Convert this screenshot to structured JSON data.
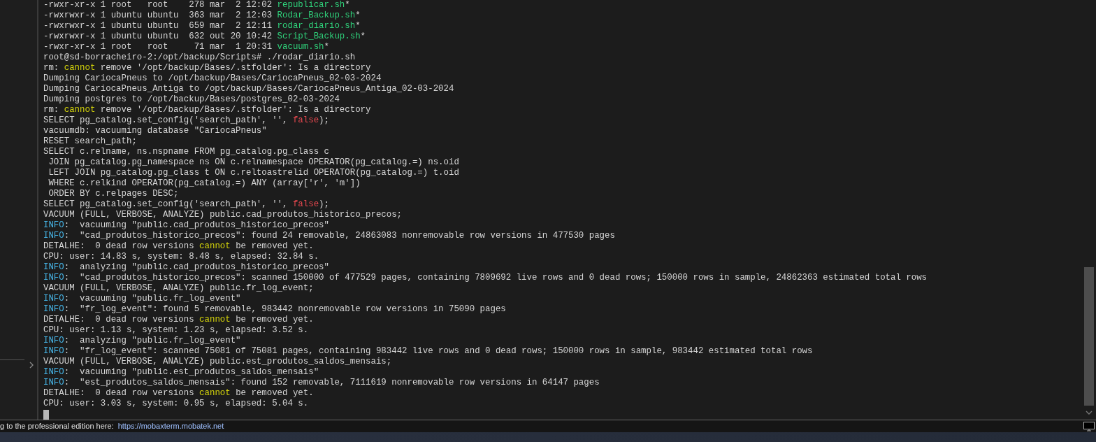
{
  "terminal": {
    "lines": [
      [
        {
          "text": "-rwxr-xr-x 1 root   root    278 mar  2 12:02 ",
          "kind": "plain"
        },
        {
          "text": "republicar.sh",
          "kind": "file"
        },
        {
          "text": "*",
          "kind": "plain"
        }
      ],
      [
        {
          "text": "-rwxrwxr-x 1 ubuntu ubuntu  363 mar  2 12:03 ",
          "kind": "plain"
        },
        {
          "text": "Rodar_Backup.sh",
          "kind": "file"
        },
        {
          "text": "*",
          "kind": "plain"
        }
      ],
      [
        {
          "text": "-rwxrwxr-x 1 ubuntu ubuntu  659 mar  2 12:11 ",
          "kind": "plain"
        },
        {
          "text": "rodar_diario.sh",
          "kind": "file"
        },
        {
          "text": "*",
          "kind": "plain"
        }
      ],
      [
        {
          "text": "-rwxrwxr-x 1 ubuntu ubuntu  632 out 20 10:42 ",
          "kind": "plain"
        },
        {
          "text": "Script_Backup.sh",
          "kind": "file"
        },
        {
          "text": "*",
          "kind": "plain"
        }
      ],
      [
        {
          "text": "-rwxr-xr-x 1 root   root     71 mar  1 20:31 ",
          "kind": "plain"
        },
        {
          "text": "vacuum.sh",
          "kind": "file"
        },
        {
          "text": "*",
          "kind": "plain"
        }
      ],
      [
        {
          "text": "root@sd-borracheiro-2:/opt/backup/Scripts# ./rodar_diario.sh",
          "kind": "plain"
        }
      ],
      [
        {
          "text": "rm: ",
          "kind": "plain"
        },
        {
          "text": "cannot",
          "kind": "warn"
        },
        {
          "text": " remove '/opt/backup/Bases/.stfolder': Is a directory",
          "kind": "plain"
        }
      ],
      [
        {
          "text": "Dumping CariocaPneus to /opt/backup/Bases/CariocaPneus_02-03-2024",
          "kind": "plain"
        }
      ],
      [
        {
          "text": "Dumping CariocaPneus_Antiga to /opt/backup/Bases/CariocaPneus_Antiga_02-03-2024",
          "kind": "plain"
        }
      ],
      [
        {
          "text": "Dumping postgres to /opt/backup/Bases/postgres_02-03-2024",
          "kind": "plain"
        }
      ],
      [
        {
          "text": "rm: ",
          "kind": "plain"
        },
        {
          "text": "cannot",
          "kind": "warn"
        },
        {
          "text": " remove '/opt/backup/Bases/.stfolder': Is a directory",
          "kind": "plain"
        }
      ],
      [
        {
          "text": "SELECT pg_catalog.set_config('search_path', '', ",
          "kind": "plain"
        },
        {
          "text": "false",
          "kind": "bool"
        },
        {
          "text": ");",
          "kind": "plain"
        }
      ],
      [
        {
          "text": "vacuumdb: vacuuming database \"CariocaPneus\"",
          "kind": "plain"
        }
      ],
      [
        {
          "text": "RESET search_path;",
          "kind": "plain"
        }
      ],
      [
        {
          "text": "SELECT c.relname, ns.nspname FROM pg_catalog.pg_class c",
          "kind": "plain"
        }
      ],
      [
        {
          "text": " JOIN pg_catalog.pg_namespace ns ON c.relnamespace OPERATOR(pg_catalog.=) ns.oid",
          "kind": "plain"
        }
      ],
      [
        {
          "text": " LEFT JOIN pg_catalog.pg_class t ON c.reltoastrelid OPERATOR(pg_catalog.=) t.oid",
          "kind": "plain"
        }
      ],
      [
        {
          "text": " WHERE c.relkind OPERATOR(pg_catalog.=) ANY (array['r', 'm'])",
          "kind": "plain"
        }
      ],
      [
        {
          "text": " ORDER BY c.relpages DESC;",
          "kind": "plain"
        }
      ],
      [
        {
          "text": "SELECT pg_catalog.set_config('search_path', '', ",
          "kind": "plain"
        },
        {
          "text": "false",
          "kind": "bool"
        },
        {
          "text": ");",
          "kind": "plain"
        }
      ],
      [
        {
          "text": "VACUUM (FULL, VERBOSE, ANALYZE) public.cad_produtos_historico_precos;",
          "kind": "plain"
        }
      ],
      [
        {
          "text": "INFO",
          "kind": "info"
        },
        {
          "text": ":  vacuuming \"public.cad_produtos_historico_precos\"",
          "kind": "plain"
        }
      ],
      [
        {
          "text": "INFO",
          "kind": "info"
        },
        {
          "text": ":  \"cad_produtos_historico_precos\": found 24 removable, 24863083 nonremovable row versions in 477530 pages",
          "kind": "plain"
        }
      ],
      [
        {
          "text": "DETALHE:  0 dead row versions ",
          "kind": "plain"
        },
        {
          "text": "cannot",
          "kind": "warn"
        },
        {
          "text": " be removed yet.",
          "kind": "plain"
        }
      ],
      [
        {
          "text": "CPU: user: 14.83 s, system: 8.48 s, elapsed: 32.84 s.",
          "kind": "plain"
        }
      ],
      [
        {
          "text": "INFO",
          "kind": "info"
        },
        {
          "text": ":  analyzing \"public.cad_produtos_historico_precos\"",
          "kind": "plain"
        }
      ],
      [
        {
          "text": "INFO",
          "kind": "info"
        },
        {
          "text": ":  \"cad_produtos_historico_precos\": scanned 150000 of 477529 pages, containing 7809692 live rows and 0 dead rows; 150000 rows in sample, 24862363 estimated total rows",
          "kind": "plain"
        }
      ],
      [
        {
          "text": "VACUUM (FULL, VERBOSE, ANALYZE) public.fr_log_event;",
          "kind": "plain"
        }
      ],
      [
        {
          "text": "INFO",
          "kind": "info"
        },
        {
          "text": ":  vacuuming \"public.fr_log_event\"",
          "kind": "plain"
        }
      ],
      [
        {
          "text": "INFO",
          "kind": "info"
        },
        {
          "text": ":  \"fr_log_event\": found 5 removable, 983442 nonremovable row versions in 75090 pages",
          "kind": "plain"
        }
      ],
      [
        {
          "text": "DETALHE:  0 dead row versions ",
          "kind": "plain"
        },
        {
          "text": "cannot",
          "kind": "warn"
        },
        {
          "text": " be removed yet.",
          "kind": "plain"
        }
      ],
      [
        {
          "text": "CPU: user: 1.13 s, system: 1.23 s, elapsed: 3.52 s.",
          "kind": "plain"
        }
      ],
      [
        {
          "text": "INFO",
          "kind": "info"
        },
        {
          "text": ":  analyzing \"public.fr_log_event\"",
          "kind": "plain"
        }
      ],
      [
        {
          "text": "INFO",
          "kind": "info"
        },
        {
          "text": ":  \"fr_log_event\": scanned 75081 of 75081 pages, containing 983442 live rows and 0 dead rows; 150000 rows in sample, 983442 estimated total rows",
          "kind": "plain"
        }
      ],
      [
        {
          "text": "VACUUM (FULL, VERBOSE, ANALYZE) public.est_produtos_saldos_mensais;",
          "kind": "plain"
        }
      ],
      [
        {
          "text": "INFO",
          "kind": "info"
        },
        {
          "text": ":  vacuuming \"public.est_produtos_saldos_mensais\"",
          "kind": "plain"
        }
      ],
      [
        {
          "text": "INFO",
          "kind": "info"
        },
        {
          "text": ":  \"est_produtos_saldos_mensais\": found 152 removable, 7111619 nonremovable row versions in 64147 pages",
          "kind": "plain"
        }
      ],
      [
        {
          "text": "DETALHE:  0 dead row versions ",
          "kind": "plain"
        },
        {
          "text": "cannot",
          "kind": "warn"
        },
        {
          "text": " be removed yet.",
          "kind": "plain"
        }
      ],
      [
        {
          "text": "CPU: user: 3.03 s, system: 0.95 s, elapsed: 5.04 s.",
          "kind": "plain"
        }
      ]
    ]
  },
  "status_bar": {
    "message": "g to the professional edition here:",
    "link": "https://mobaxterm.mobatek.net"
  }
}
